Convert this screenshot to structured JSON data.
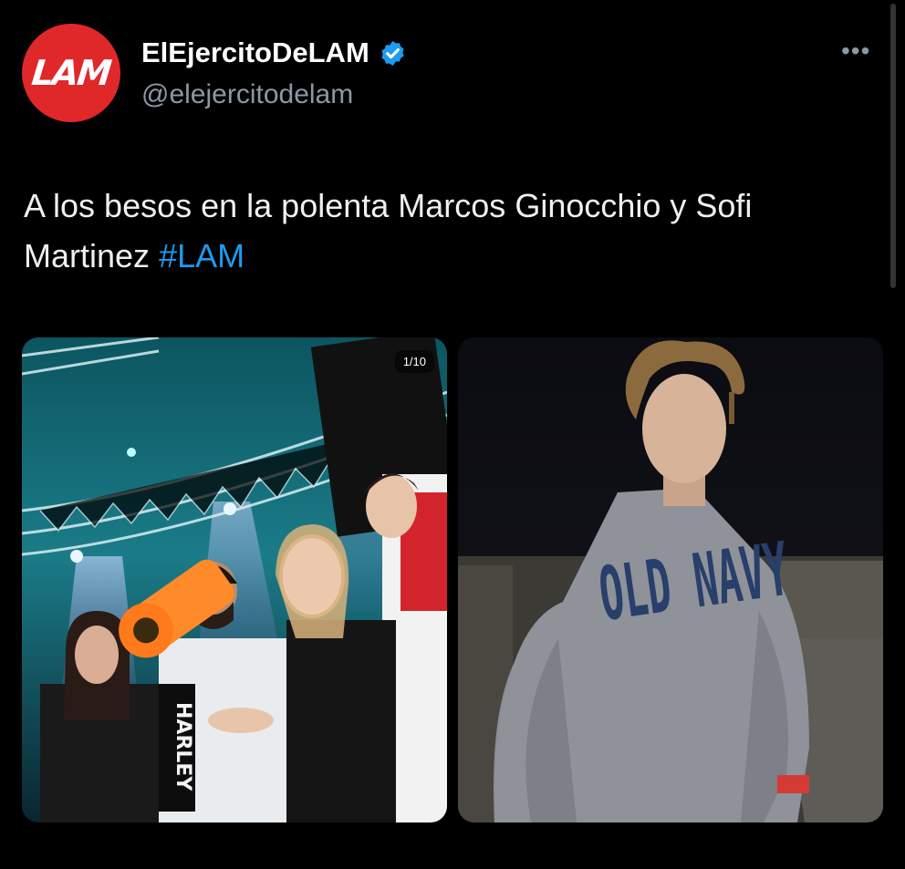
{
  "tweet": {
    "avatar_text": "LAM",
    "display_name": "ElEjercitoDeLAM",
    "handle": "@elejercitodelam",
    "text": "A los besos en la polenta Marcos Ginocchio y Sofi Martinez",
    "hashtag": "#LAM",
    "more_icon": "more-horizontal-icon",
    "verified_icon": "verified-badge-icon"
  },
  "media": {
    "counter": "1/10",
    "photo1": {
      "shirt_text": "HARLEY"
    },
    "photo2": {
      "sweater_text": "OLD NAVY"
    }
  },
  "colors": {
    "accent": "#1d9bf0",
    "brand": "#e0282b",
    "background": "#000000"
  }
}
